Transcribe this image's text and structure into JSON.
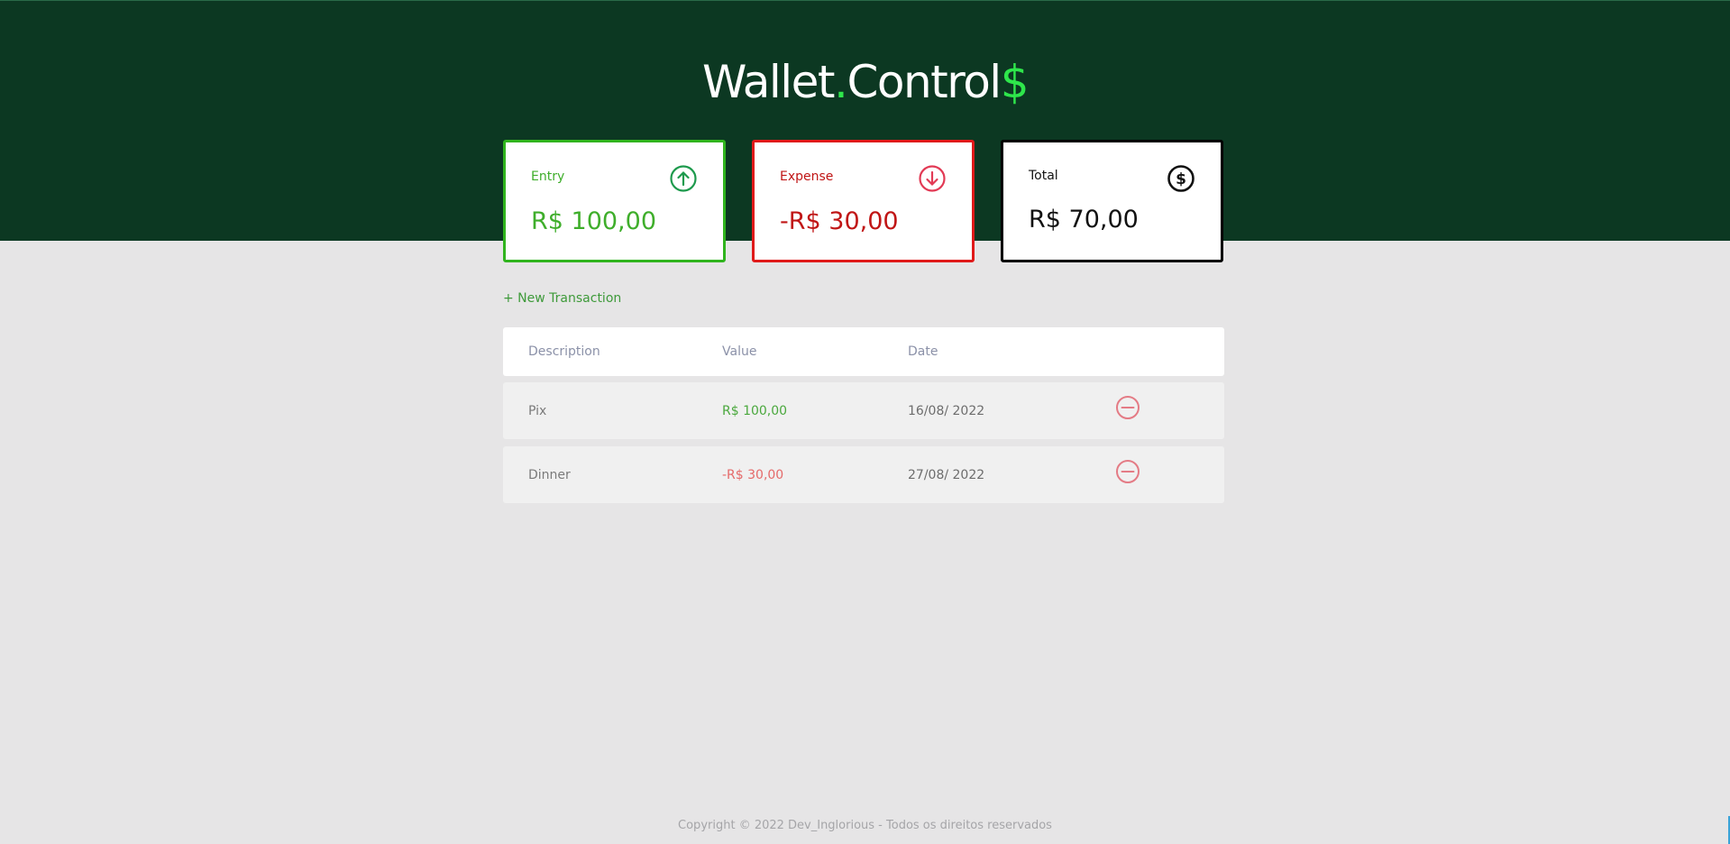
{
  "header": {
    "logo_part1": "Wallet",
    "logo_dot": ".",
    "logo_part2": "Control",
    "logo_dollar": "$"
  },
  "cards": {
    "entry": {
      "label": "Entry",
      "amount": "R$ 100,00",
      "icon": "arrow-up-circle-icon",
      "color": "#3fae2b"
    },
    "expense": {
      "label": "Expense",
      "amount": "-R$ 30,00",
      "icon": "arrow-down-circle-icon",
      "color": "#c01515"
    },
    "total": {
      "label": "Total",
      "amount": "R$ 70,00",
      "icon": "dollar-circle-icon",
      "color": "#111111"
    }
  },
  "new_transaction_label": "+ New Transaction",
  "table": {
    "headers": [
      "Description",
      "Value",
      "Date"
    ],
    "rows": [
      {
        "description": "Pix",
        "value": "R$ 100,00",
        "date": "16/08/ 2022",
        "type": "income"
      },
      {
        "description": "Dinner",
        "value": "-R$ 30,00",
        "date": "27/08/ 2022",
        "type": "expense"
      }
    ]
  },
  "footer": "Copyright © 2022 Dev_Inglorious - Todos os direitos reservados",
  "colors": {
    "header_bg": "#0c3822",
    "accent_green": "#2ee64b",
    "page_bg": "#e6e5e6",
    "remove_icon": "#e47b85"
  }
}
